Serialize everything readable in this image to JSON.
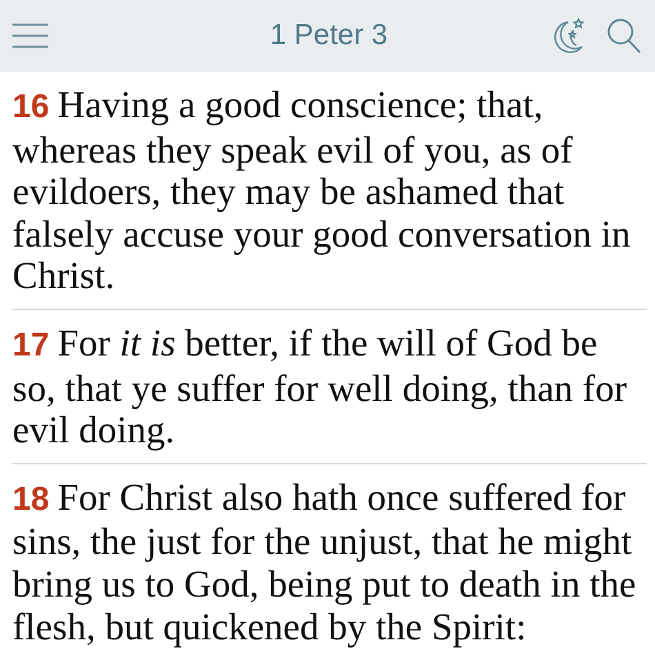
{
  "header": {
    "title": "1 Peter 3"
  },
  "verses": [
    {
      "number": "16",
      "text": "Having a good conscience; that, whereas they speak evil of you, as of evildoers, they may be ashamed that falsely accuse your good conversation in Christ."
    },
    {
      "number": "17",
      "text": "For *it is* better, if the will of God be so, that ye suffer for well doing, than for evil doing."
    },
    {
      "number": "18",
      "text": "For Christ also hath once suffered for sins, the just for the unjust, that he might bring us to God, being put to death in the flesh, but quickened by the Spirit:"
    }
  ]
}
